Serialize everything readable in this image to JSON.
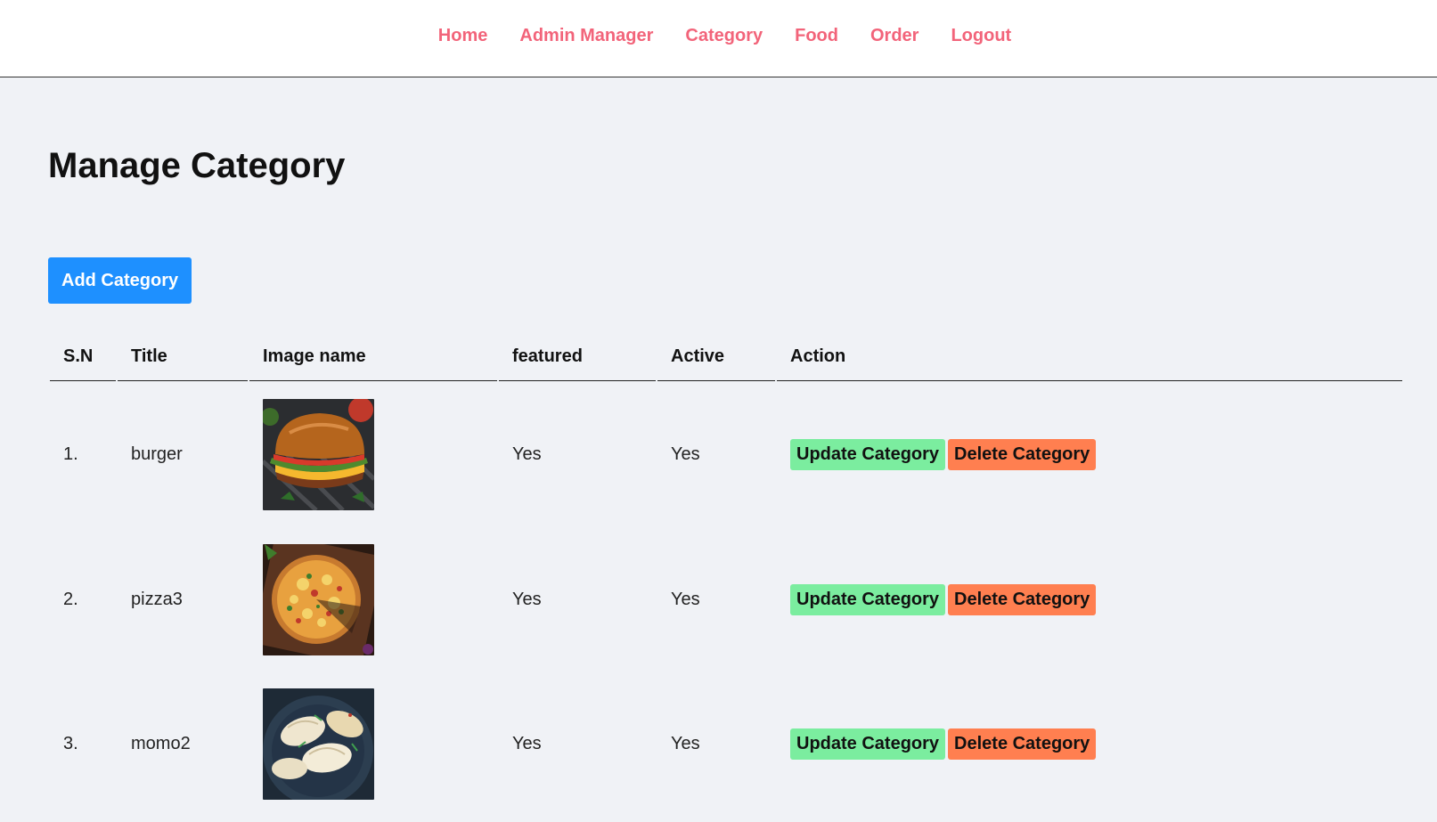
{
  "nav": {
    "items": [
      {
        "label": "Home"
      },
      {
        "label": "Admin Manager"
      },
      {
        "label": "Category"
      },
      {
        "label": "Food"
      },
      {
        "label": "Order"
      },
      {
        "label": "Logout"
      }
    ]
  },
  "page": {
    "title": "Manage Category",
    "add_button": "Add Category"
  },
  "table": {
    "headers": [
      "S.N",
      "Title",
      "Image name",
      "featured",
      "Active",
      "Action"
    ],
    "rows": [
      {
        "sn": "1.",
        "title": "burger",
        "image": "burger-photo",
        "featured": "Yes",
        "active": "Yes",
        "update": "Update Category",
        "delete": "Delete Category"
      },
      {
        "sn": "2.",
        "title": "pizza3",
        "image": "pizza-photo",
        "featured": "Yes",
        "active": "Yes",
        "update": "Update Category",
        "delete": "Delete Category"
      },
      {
        "sn": "3.",
        "title": "momo2",
        "image": "momo-photo",
        "featured": "Yes",
        "active": "Yes",
        "update": "Update Category",
        "delete": "Delete Category"
      }
    ]
  },
  "colors": {
    "nav_link": "#f2647a",
    "add_button": "#1e90ff",
    "update_button": "#7bed9f",
    "delete_button": "#ff7f50",
    "page_bg": "#f0f2f6"
  }
}
